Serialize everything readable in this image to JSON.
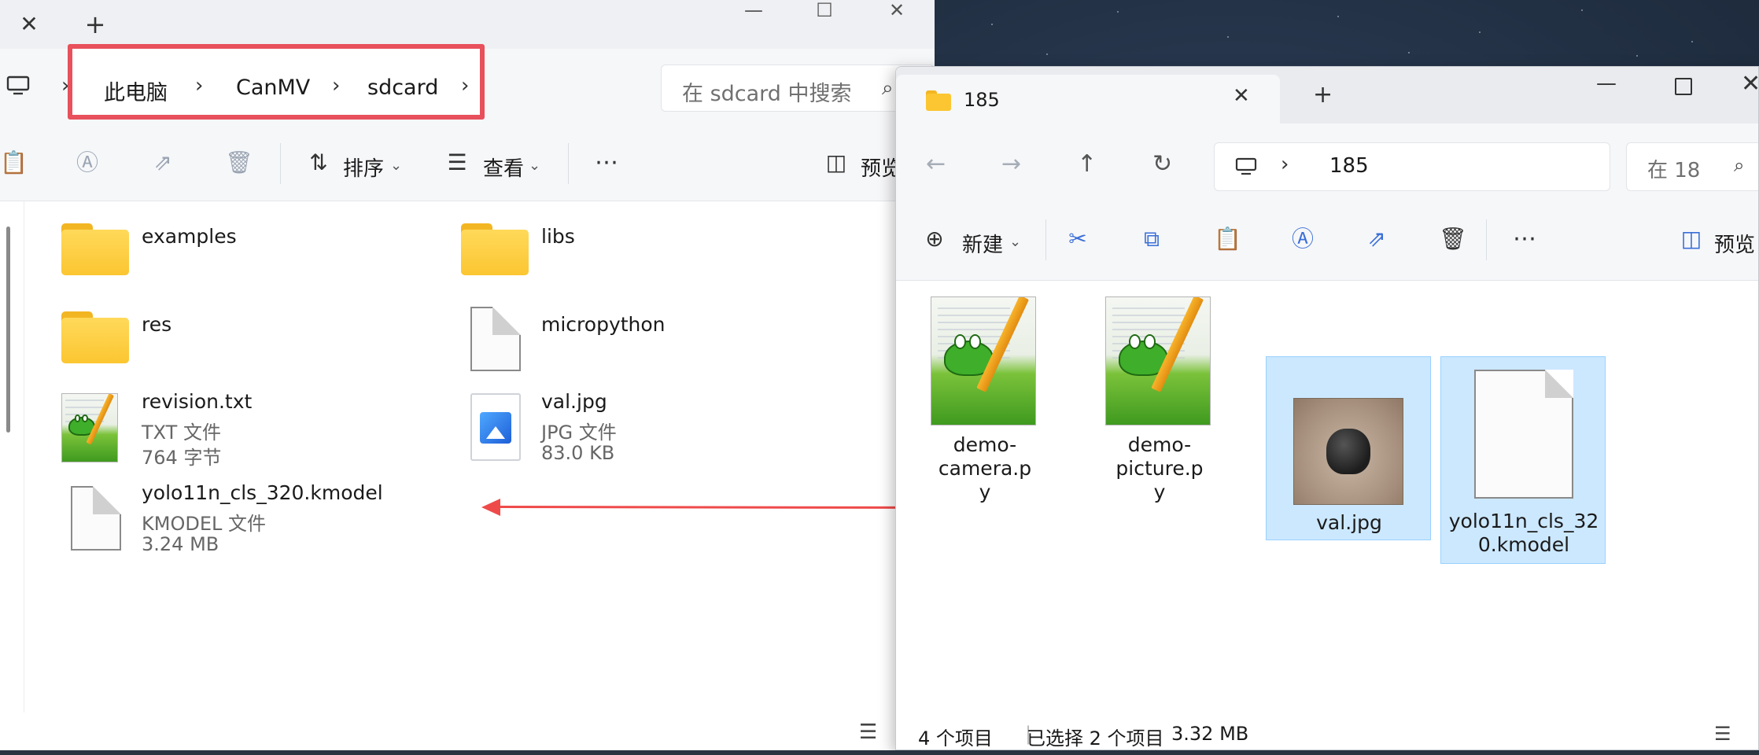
{
  "left_window": {
    "breadcrumb": [
      "此电脑",
      "CanMV",
      "sdcard"
    ],
    "search_placeholder": "在 sdcard 中搜索",
    "toolbar": {
      "sort_label": "排序",
      "view_label": "查看",
      "preview_label": "预览"
    },
    "items": [
      {
        "name": "examples",
        "type": "folder"
      },
      {
        "name": "libs",
        "type": "folder"
      },
      {
        "name": "res",
        "type": "folder"
      },
      {
        "name": "micropython",
        "type": "file"
      },
      {
        "name": "revision.txt",
        "type": "notepad",
        "kind": "TXT 文件",
        "size": "764 字节"
      },
      {
        "name": "val.jpg",
        "type": "image",
        "kind": "JPG 文件",
        "size": "83.0 KB"
      },
      {
        "name": "yolo11n_cls_320.kmodel",
        "type": "file",
        "kind": "KMODEL 文件",
        "size": "3.24 MB"
      }
    ]
  },
  "right_window": {
    "tab_title": "185",
    "address": "185",
    "search_placeholder": "在 18",
    "toolbar": {
      "new_label": "新建",
      "preview_label": "预览"
    },
    "items": [
      {
        "name_line1": "demo-camera.p",
        "name_line2": "y",
        "type": "notepad",
        "selected": false
      },
      {
        "name_line1": "demo-picture.p",
        "name_line2": "y",
        "type": "notepad",
        "selected": false
      },
      {
        "name_line1": "val.jpg",
        "name_line2": "",
        "type": "photo",
        "selected": true
      },
      {
        "name_line1": "yolo11n_cls_32",
        "name_line2": "0.kmodel",
        "type": "file",
        "selected": true
      }
    ],
    "status": {
      "count": "4 个项目",
      "selected": "已选择 2 个项目",
      "size": "3.32 MB"
    }
  },
  "colors": {
    "highlight_border": "#e8505b",
    "arrow": "#ef4a4a",
    "selection_bg": "#cce8ff",
    "folder": "#fbc631"
  }
}
